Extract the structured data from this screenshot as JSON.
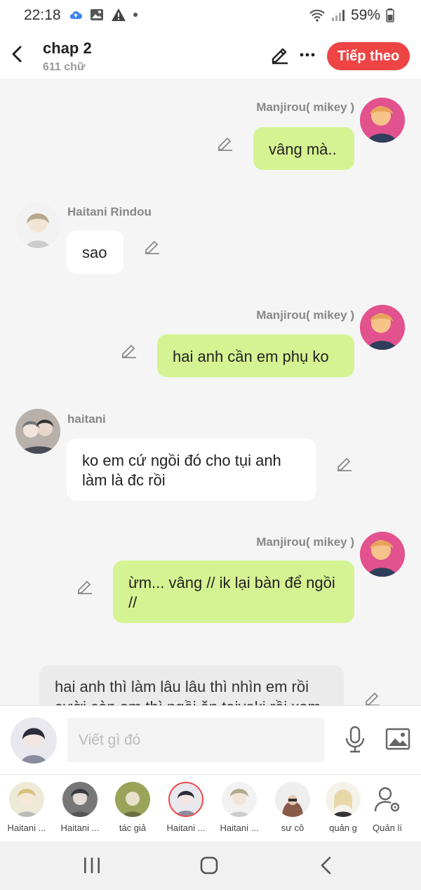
{
  "status_bar": {
    "time": "22:18",
    "battery": "59%"
  },
  "header": {
    "title": "chap 2",
    "word_count": "611 chữ",
    "next_label": "Tiếp theo",
    "accent_color": "#ef4444"
  },
  "messages": [
    {
      "sender": "Manjirou( mikey )",
      "text": "vâng mà..",
      "side": "right"
    },
    {
      "sender": "Haitani Rindou",
      "text": "sao",
      "side": "left"
    },
    {
      "sender": "Manjirou( mikey )",
      "text": "hai anh cần em phụ ko",
      "side": "right"
    },
    {
      "sender": "haitani",
      "text": "ko em cứ ngồi đó cho tụi anh làm là đc rồi",
      "side": "left"
    },
    {
      "sender": "Manjirou( mikey )",
      "text": "ừm... vâng // ik lại bàn để ngồi //",
      "side": "right"
    },
    {
      "sender": "",
      "text": "hai anh thì làm lâu lâu thì nhìn em rồi cười còn em thì ngồi ăn taiyaki rồi xem hai anh",
      "side": "narration"
    }
  ],
  "input": {
    "placeholder": "Viết gì đó"
  },
  "characters": [
    {
      "label": "Haitani ..."
    },
    {
      "label": "Haitani ..."
    },
    {
      "label": "tác giả"
    },
    {
      "label": "Haitani ..."
    },
    {
      "label": "Haitani ..."
    },
    {
      "label": "sư cô"
    },
    {
      "label": "quản g"
    },
    {
      "label": "Quản lí"
    }
  ],
  "colors": {
    "user_bubble": "#d5f392",
    "other_bubble": "#ffffff",
    "background": "#f5f5f5"
  }
}
